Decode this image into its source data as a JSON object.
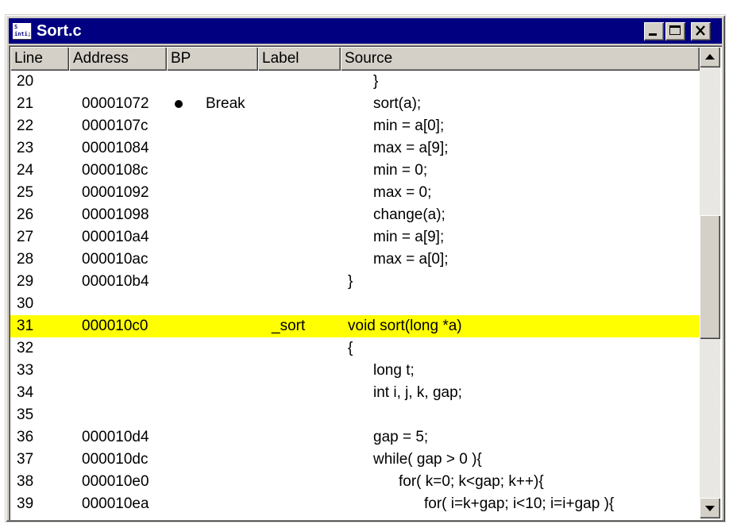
{
  "window": {
    "title": "Sort.c",
    "icon_text_top": "S",
    "icon_text_bottom": "inti;",
    "minimize_icon": "minimize-icon",
    "maximize_icon": "maximize-icon",
    "close_icon": "close-icon"
  },
  "columns": [
    "Line",
    "Address",
    "BP",
    "Label",
    "Source"
  ],
  "rows": [
    {
      "line": "20",
      "address": "",
      "bp": "",
      "label": "",
      "source": "}",
      "indent": 1
    },
    {
      "line": "21",
      "address": "00001072",
      "bp": "Break",
      "has_breakpoint": true,
      "label": "",
      "source": "sort(a);",
      "indent": 1
    },
    {
      "line": "22",
      "address": "0000107c",
      "bp": "",
      "label": "",
      "source": "min = a[0];",
      "indent": 1
    },
    {
      "line": "23",
      "address": "00001084",
      "bp": "",
      "label": "",
      "source": "max = a[9];",
      "indent": 1
    },
    {
      "line": "24",
      "address": "0000108c",
      "bp": "",
      "label": "",
      "source": "min = 0;",
      "indent": 1
    },
    {
      "line": "25",
      "address": "00001092",
      "bp": "",
      "label": "",
      "source": "max = 0;",
      "indent": 1
    },
    {
      "line": "26",
      "address": "00001098",
      "bp": "",
      "label": "",
      "source": "change(a);",
      "indent": 1
    },
    {
      "line": "27",
      "address": "000010a4",
      "bp": "",
      "label": "",
      "source": "min = a[9];",
      "indent": 1
    },
    {
      "line": "28",
      "address": "000010ac",
      "bp": "",
      "label": "",
      "source": "max = a[0];",
      "indent": 1
    },
    {
      "line": "29",
      "address": "000010b4",
      "bp": "",
      "label": "",
      "source": "}",
      "indent": 0
    },
    {
      "line": "30",
      "address": "",
      "bp": "",
      "label": "",
      "source": "",
      "indent": 0
    },
    {
      "line": "31",
      "address": "000010c0",
      "bp": "",
      "label": "_sort",
      "source": "void sort(long *a)",
      "indent": 0,
      "current": true
    },
    {
      "line": "32",
      "address": "",
      "bp": "",
      "label": "",
      "source": "{",
      "indent": 0
    },
    {
      "line": "33",
      "address": "",
      "bp": "",
      "label": "",
      "source": "long t;",
      "indent": 1
    },
    {
      "line": "34",
      "address": "",
      "bp": "",
      "label": "",
      "source": "int i, j, k, gap;",
      "indent": 1
    },
    {
      "line": "35",
      "address": "",
      "bp": "",
      "label": "",
      "source": "",
      "indent": 1
    },
    {
      "line": "36",
      "address": "000010d4",
      "bp": "",
      "label": "",
      "source": "gap = 5;",
      "indent": 1
    },
    {
      "line": "37",
      "address": "000010dc",
      "bp": "",
      "label": "",
      "source": "while( gap > 0 ){",
      "indent": 1
    },
    {
      "line": "38",
      "address": "000010e0",
      "bp": "",
      "label": "",
      "source": "for( k=0; k<gap; k++){",
      "indent": 2
    },
    {
      "line": "39",
      "address": "000010ea",
      "bp": "",
      "label": "",
      "source": "for( i=k+gap; i<10; i=i+gap ){",
      "indent": 3
    }
  ],
  "colors": {
    "titlebar": "#000080",
    "current_line": "#ffff00",
    "chrome": "#d4d0c8"
  },
  "scrollbar": {
    "up_icon": "scroll-up-arrow-icon",
    "down_icon": "scroll-down-arrow-icon"
  }
}
